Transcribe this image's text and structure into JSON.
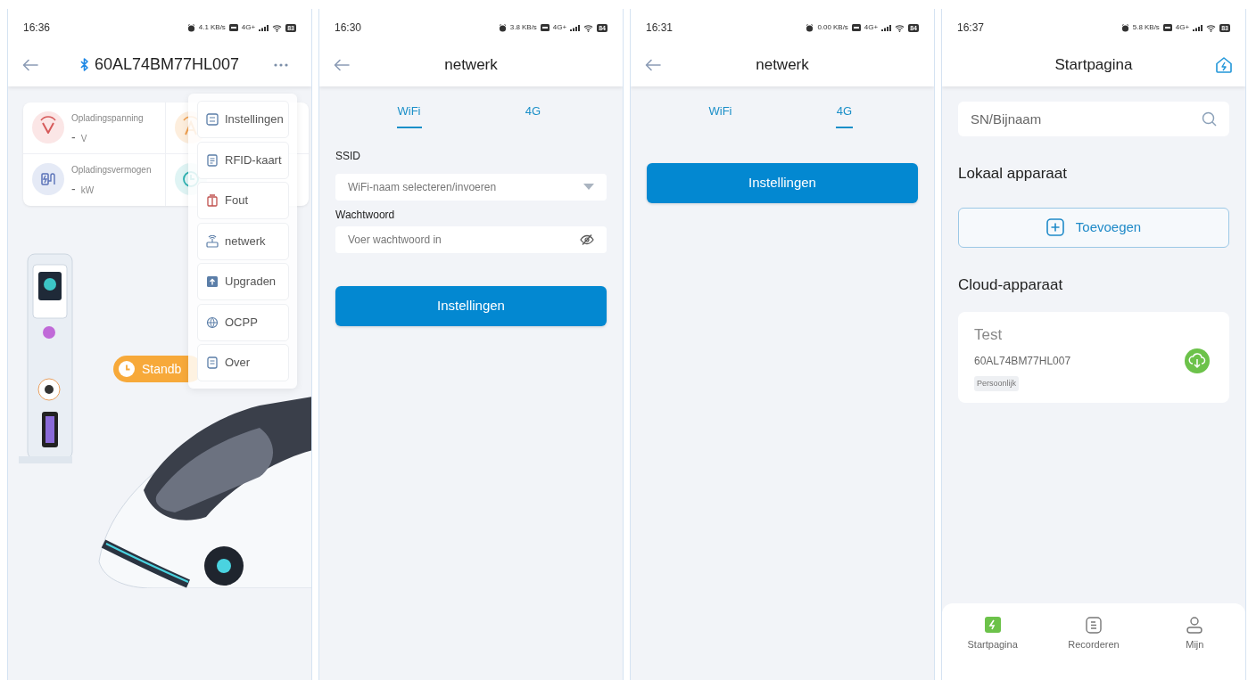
{
  "screens": [
    {
      "kind": "device",
      "status": {
        "time": "16:36",
        "speed": "4.1",
        "speed_unit": "KB/s",
        "network": "4G+",
        "battery": "83"
      },
      "title": "60AL74BM77HL007",
      "bluetooth": true,
      "metrics": [
        {
          "kind": "voltage",
          "label": "Opladingspanning",
          "value": "-",
          "unit": "V"
        },
        {
          "kind": "current"
        },
        {
          "kind": "power",
          "label": "Opladingsvermogen",
          "value": "-",
          "unit": "kW"
        },
        {
          "kind": "time"
        }
      ],
      "status_badge": "Standb",
      "menu": [
        {
          "kind": "settings",
          "label": "Instellingen"
        },
        {
          "kind": "card",
          "label": "RFID-kaart"
        },
        {
          "kind": "fault",
          "label": "Fout"
        },
        {
          "kind": "network",
          "label": "netwerk"
        },
        {
          "kind": "upgrade",
          "label": "Upgraden"
        },
        {
          "kind": "globe",
          "label": "OCPP"
        },
        {
          "kind": "info",
          "label": "Over"
        }
      ]
    },
    {
      "kind": "network",
      "status": {
        "time": "16:30",
        "speed": "3.8",
        "speed_unit": "KB/s",
        "network": "4G+",
        "battery": "84"
      },
      "title": "netwerk",
      "tabs": [
        {
          "label": "WiFi",
          "selected": true
        },
        {
          "label": "4G",
          "selected": false
        }
      ],
      "fields": [
        {
          "kind": "select",
          "label": "SSID",
          "placeholder": "WiFi-naam selecteren/invoeren"
        },
        {
          "kind": "password",
          "label": "Wachtwoord",
          "placeholder": "Voer wachtwoord in"
        }
      ],
      "button": "Instellingen"
    },
    {
      "kind": "network",
      "status": {
        "time": "16:31",
        "speed": "0.00",
        "speed_unit": "KB/s",
        "network": "4G+",
        "battery": "84"
      },
      "title": "netwerk",
      "tabs": [
        {
          "label": "WiFi",
          "selected": false
        },
        {
          "label": "4G",
          "selected": true
        }
      ],
      "button": "Instellingen"
    },
    {
      "kind": "home",
      "status": {
        "time": "16:37",
        "speed": "5.8",
        "speed_unit": "KB/s",
        "network": "4G+",
        "battery": "83"
      },
      "title": "Startpagina",
      "search": {
        "placeholder": "SN/Bijnaam"
      },
      "local_title": "Lokaal apparaat",
      "add_button": "Toevoegen",
      "cloud_title": "Cloud-apparaat",
      "devices": [
        {
          "name": "Test",
          "serial": "60AL74BM77HL007",
          "tag": "Persoonlijk"
        }
      ],
      "nav": [
        {
          "kind": "home",
          "label": "Startpagina",
          "selected": true
        },
        {
          "kind": "records",
          "label": "Recorderen",
          "selected": false
        },
        {
          "kind": "user",
          "label": "Mijn",
          "selected": false
        }
      ]
    }
  ]
}
